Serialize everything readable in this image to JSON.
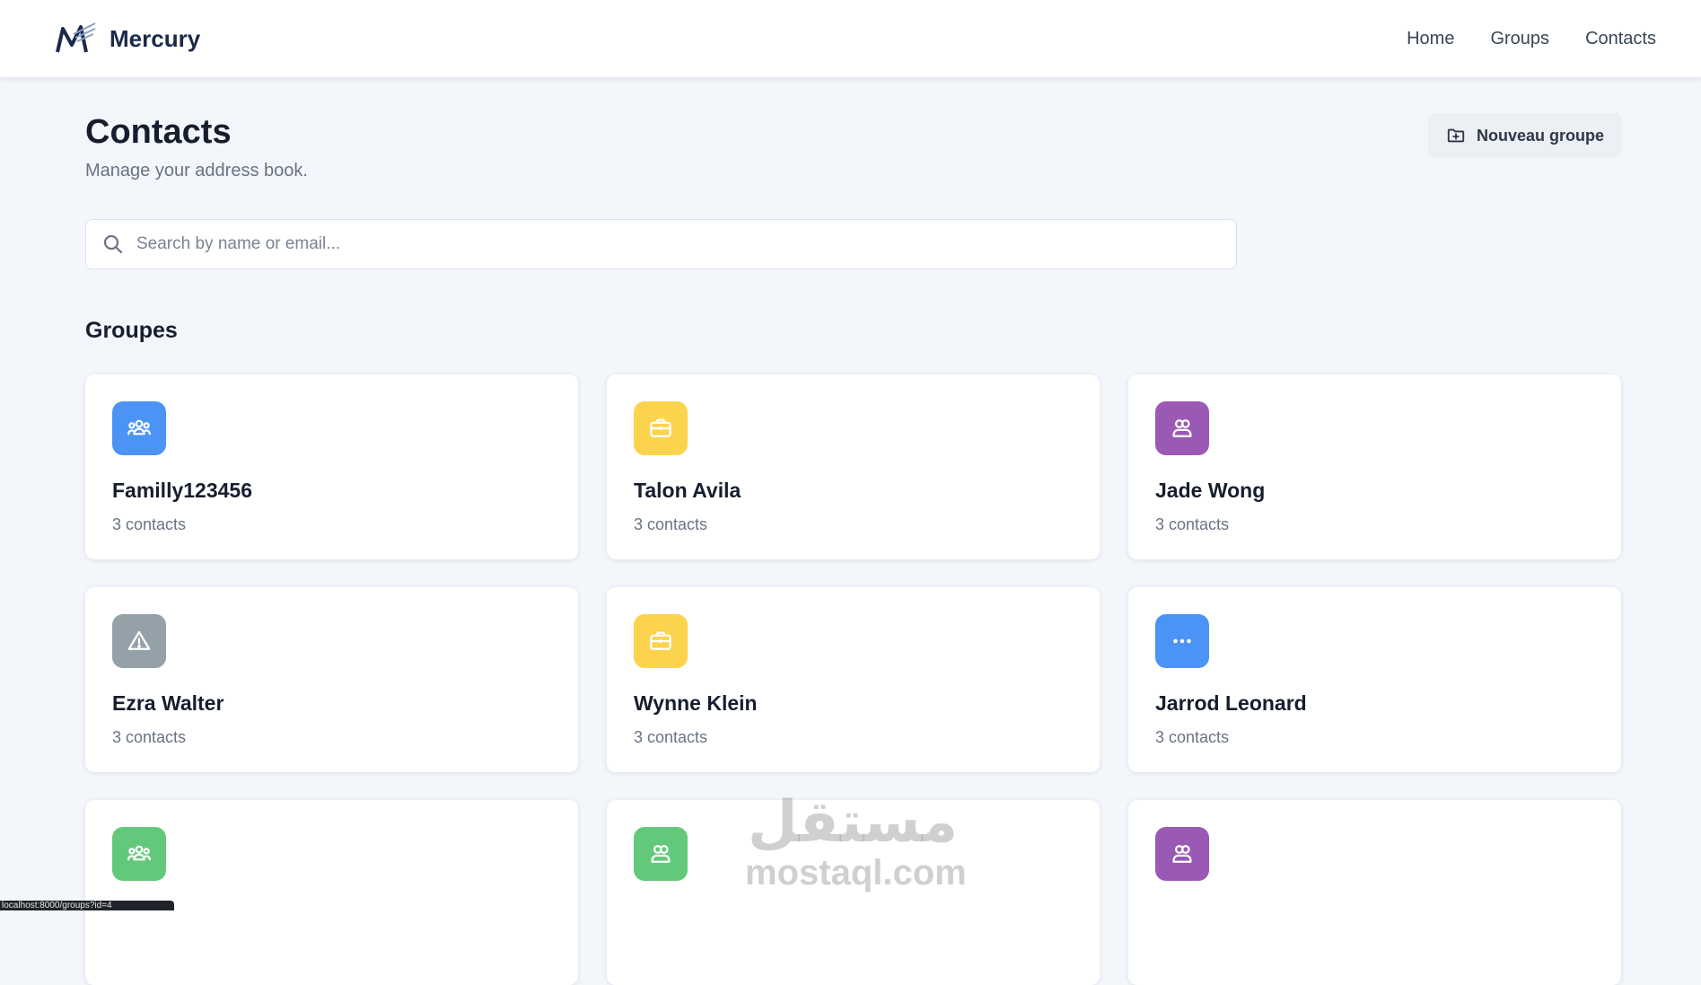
{
  "brand": {
    "name": "Mercury",
    "accent": "#1b2a4a"
  },
  "nav": {
    "items": [
      {
        "label": "Home"
      },
      {
        "label": "Groups"
      },
      {
        "label": "Contacts"
      }
    ]
  },
  "header": {
    "title": "Contacts",
    "subtitle": "Manage your address book.",
    "new_group_label": "Nouveau groupe"
  },
  "search": {
    "placeholder": "Search by name or email..."
  },
  "groups": {
    "section_title": "Groupes",
    "items": [
      {
        "name": "Familly123456",
        "count": "3 contacts",
        "icon": "users-group-icon",
        "color": "#4b94f6"
      },
      {
        "name": "Talon Avila",
        "count": "3 contacts",
        "icon": "briefcase-icon",
        "color": "#fcd34d"
      },
      {
        "name": "Jade Wong",
        "count": "3 contacts",
        "icon": "user-pair-icon",
        "color": "#9b59b6"
      },
      {
        "name": "Ezra Walter",
        "count": "3 contacts",
        "icon": "warning-icon",
        "color": "#95a1a8"
      },
      {
        "name": "Wynne Klein",
        "count": "3 contacts",
        "icon": "briefcase-icon",
        "color": "#fcd34d"
      },
      {
        "name": "Jarrod Leonard",
        "count": "3 contacts",
        "icon": "more-dots-icon",
        "color": "#4b94f6"
      },
      {
        "name": "",
        "count": "",
        "icon": "users-group-icon",
        "color": "#62c97b"
      },
      {
        "name": "",
        "count": "",
        "icon": "user-pair-icon",
        "color": "#62c97b"
      },
      {
        "name": "",
        "count": "",
        "icon": "user-pair-icon",
        "color": "#9b59b6"
      }
    ]
  },
  "watermark": {
    "arabic": "مستقل",
    "latin": "mostaql.com"
  },
  "status_bar": {
    "text": "localhost:8000/groups?id=4"
  }
}
